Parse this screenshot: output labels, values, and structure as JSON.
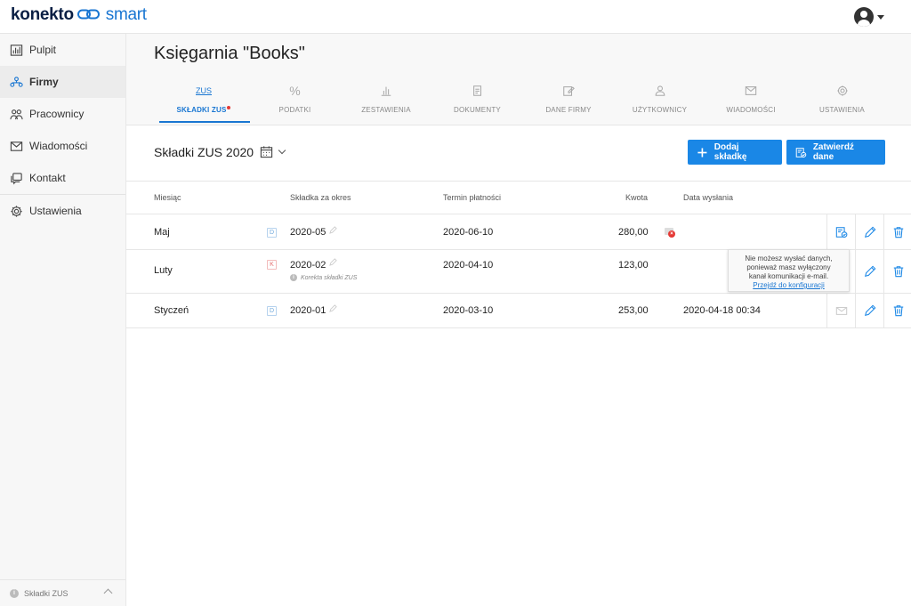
{
  "app": {
    "logo_main": "konekto",
    "logo_accent": "smart"
  },
  "sidebar": {
    "items": [
      {
        "label": "Pulpit",
        "icon": "dashboard-icon"
      },
      {
        "label": "Firmy",
        "icon": "companies-icon"
      },
      {
        "label": "Pracownicy",
        "icon": "employees-icon"
      },
      {
        "label": "Wiadomości",
        "icon": "mail-icon"
      },
      {
        "label": "Kontakt",
        "icon": "contact-icon"
      },
      {
        "label": "Ustawienia",
        "icon": "gear-icon"
      }
    ],
    "footer_label": "Składki ZUS"
  },
  "header": {
    "title": "Księgarnia \"Books\""
  },
  "tabs": [
    {
      "icon_text": "ZUS",
      "label": "SKŁADKI ZUS"
    },
    {
      "icon_text": "%",
      "label": "PODATKI"
    },
    {
      "label": "ZESTAWIENIA"
    },
    {
      "label": "DOKUMENTY"
    },
    {
      "label": "DANE FIRMY"
    },
    {
      "label": "UŻYTKOWNICY"
    },
    {
      "label": "WIADOMOŚCI"
    },
    {
      "label": "USTAWIENIA"
    }
  ],
  "section": {
    "title": "Składki ZUS 2020",
    "add_button": "Dodaj składkę",
    "confirm_button": "Zatwierdź dane"
  },
  "table": {
    "headers": {
      "month": "Miesiąc",
      "period": "Składka za okres",
      "due": "Termin płatności",
      "amount": "Kwota",
      "sent": "Data wysłania"
    },
    "rows": [
      {
        "month": "Maj",
        "badge": "D",
        "period": "2020-05",
        "note": "",
        "due": "2020-06-10",
        "amount": "280,00",
        "sent": ""
      },
      {
        "month": "Luty",
        "badge": "K",
        "period": "2020-02",
        "note": "Korekta składki ZUS",
        "due": "2020-04-10",
        "amount": "123,00",
        "sent": ""
      },
      {
        "month": "Styczeń",
        "badge": "D",
        "period": "2020-01",
        "note": "",
        "due": "2020-03-10",
        "amount": "253,00",
        "sent": "2020-04-18 00:34"
      }
    ]
  },
  "tooltip": {
    "line1": "Nie możesz wysłać danych,",
    "line2": "ponieważ masz wyłączony",
    "line3": "kanał komunikacji e-mail.",
    "link": "Przejdź do konfiguracji"
  },
  "colors": {
    "accent": "#1a87e6",
    "error": "#e53935",
    "sidebar_bg": "#f7f7f7"
  }
}
